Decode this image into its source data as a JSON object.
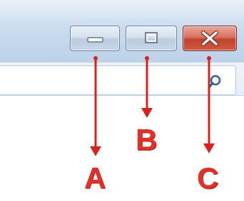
{
  "window": {
    "caption_buttons": {
      "minimize": {
        "icon": "minimize-icon"
      },
      "maximize": {
        "icon": "maximize-icon"
      },
      "close": {
        "icon": "close-icon"
      }
    },
    "search": {
      "icon": "search-icon"
    }
  },
  "callouts": {
    "a_label": "A",
    "b_label": "B",
    "c_label": "C",
    "color": "#e0302a"
  },
  "colors": {
    "titlebar": "#c6d8ec",
    "close_button": "#c2412c"
  }
}
